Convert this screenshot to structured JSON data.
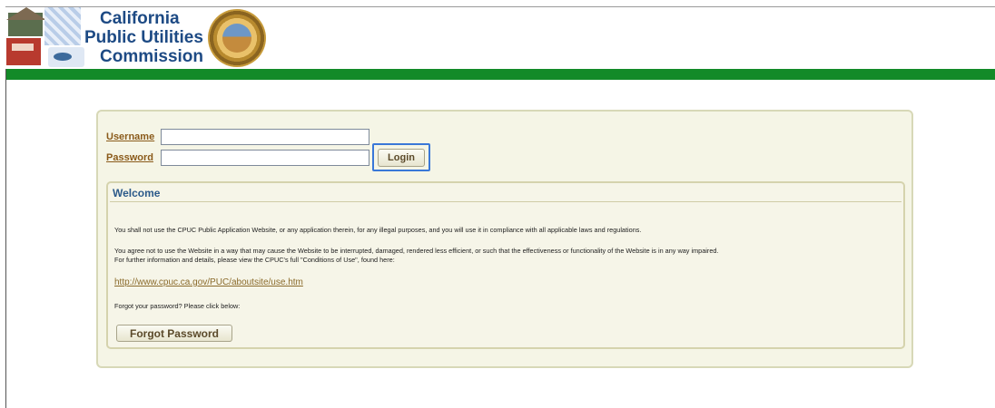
{
  "header": {
    "org_name_lines": [
      "California",
      "Public Utilities",
      "Commission"
    ],
    "colors": {
      "green_bar": "#138a28",
      "title_blue": "#1d4a84"
    }
  },
  "login": {
    "username_label": "Username",
    "username_value": "",
    "password_label": "Password",
    "password_value": "",
    "login_button": "Login"
  },
  "welcome": {
    "title": "Welcome",
    "paragraph1": "You shall not use the CPUC Public Application Website, or any application therein, for any illegal purposes, and you will use it in compliance with all applicable laws and regulations.",
    "paragraph2_line1": "You agree not to use the Website in a way that may cause the Website to be interrupted, damaged, rendered less efficient, or such that the effectiveness or functionality of the Website is in any way impaired.",
    "paragraph2_line2": "For further information and details, please view the CPUC's full \"Conditions of Use\", found here:",
    "link": "http://www.cpuc.ca.gov/PUC/aboutsite/use.htm",
    "forgot_prompt": "Forgot your password? Please click below:",
    "forgot_button": "Forgot Password"
  }
}
